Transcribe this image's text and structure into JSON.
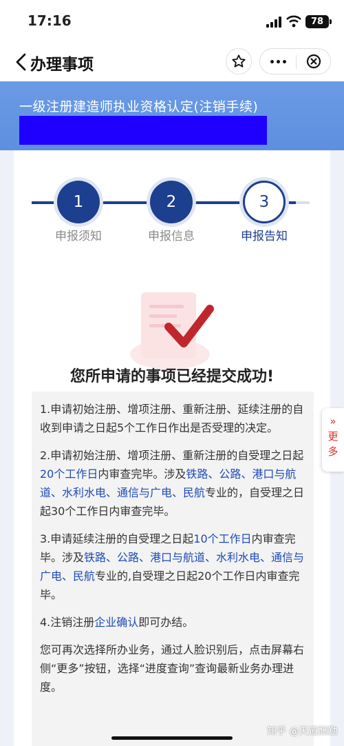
{
  "status_bar": {
    "time": "17:16",
    "battery": "78"
  },
  "nav": {
    "title": "办理事项"
  },
  "banner": {
    "title": "一级注册建造师执业资格认定(注销手续)"
  },
  "steps": [
    {
      "number": "1",
      "label": "申报须知"
    },
    {
      "number": "2",
      "label": "申报信息"
    },
    {
      "number": "3",
      "label": "申报告知"
    }
  ],
  "success_message": "您所申请的事项已经提交成功!",
  "notice": {
    "p1": "1.申请初始注册、增项注册、重新注册、延续注册的自收到申请之日起5个工作日作出是否受理的决定。",
    "p2": {
      "a": "2.申请初始注册、增项注册、重新注册的自受理之日起",
      "b": "20个工作日",
      "c": "内审查完毕。涉及",
      "d": "铁路、公路、港口与航道、水利水电、通信与广电、民航",
      "e": "专业的，自受理之日起30个工作日内审查完毕。"
    },
    "p3": {
      "a": "3.申请延续注册的自受理之日起",
      "b": "10个工作日",
      "c": "内审查完毕。涉及",
      "d": "铁路、公路、港口与航道、水利水电、通信与广电、民航",
      "e": "专业的,自受理之日起20个工作日内审查完毕。"
    },
    "p4": {
      "a": "4.注销注册",
      "b": "企业确认",
      "c": "即可办结。"
    },
    "p5": "您可再次选择所办业务，通过人脸识别后，点击屏幕右侧“更多”按钮，选择“进度查询”查询最新业务办理进度。"
  },
  "side_button": {
    "arrow": "»",
    "line1": "更",
    "line2": "多"
  },
  "watermark": "知乎 @天道酬勤",
  "colors": {
    "primary": "#1d3f8f",
    "banner": "#5d8fe0",
    "link": "#1d4bb8",
    "check": "#c0272d"
  }
}
